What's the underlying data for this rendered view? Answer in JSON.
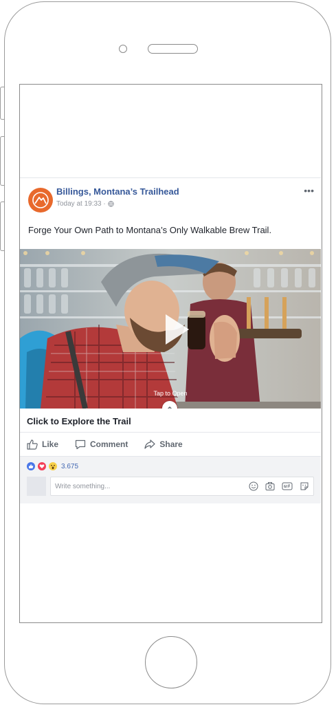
{
  "post": {
    "author": "Billings, Montana’s Trailhead",
    "timestamp": "Today at 19:33 ·",
    "more_label": "•••",
    "text": "Forge Your Own Path to Montana’s Only Walkable Brew Trail.",
    "video": {
      "tap_label": "Tap to Open"
    },
    "cta_title": "Click to Explore the Trail",
    "actions": {
      "like": "Like",
      "comment": "Comment",
      "share": "Share"
    },
    "reaction_count": "3.675",
    "comment_placeholder": "Write something..."
  },
  "colors": {
    "author_link": "#365899",
    "brand_orange": "#e8692c",
    "reaction_count": "#4267b2"
  }
}
